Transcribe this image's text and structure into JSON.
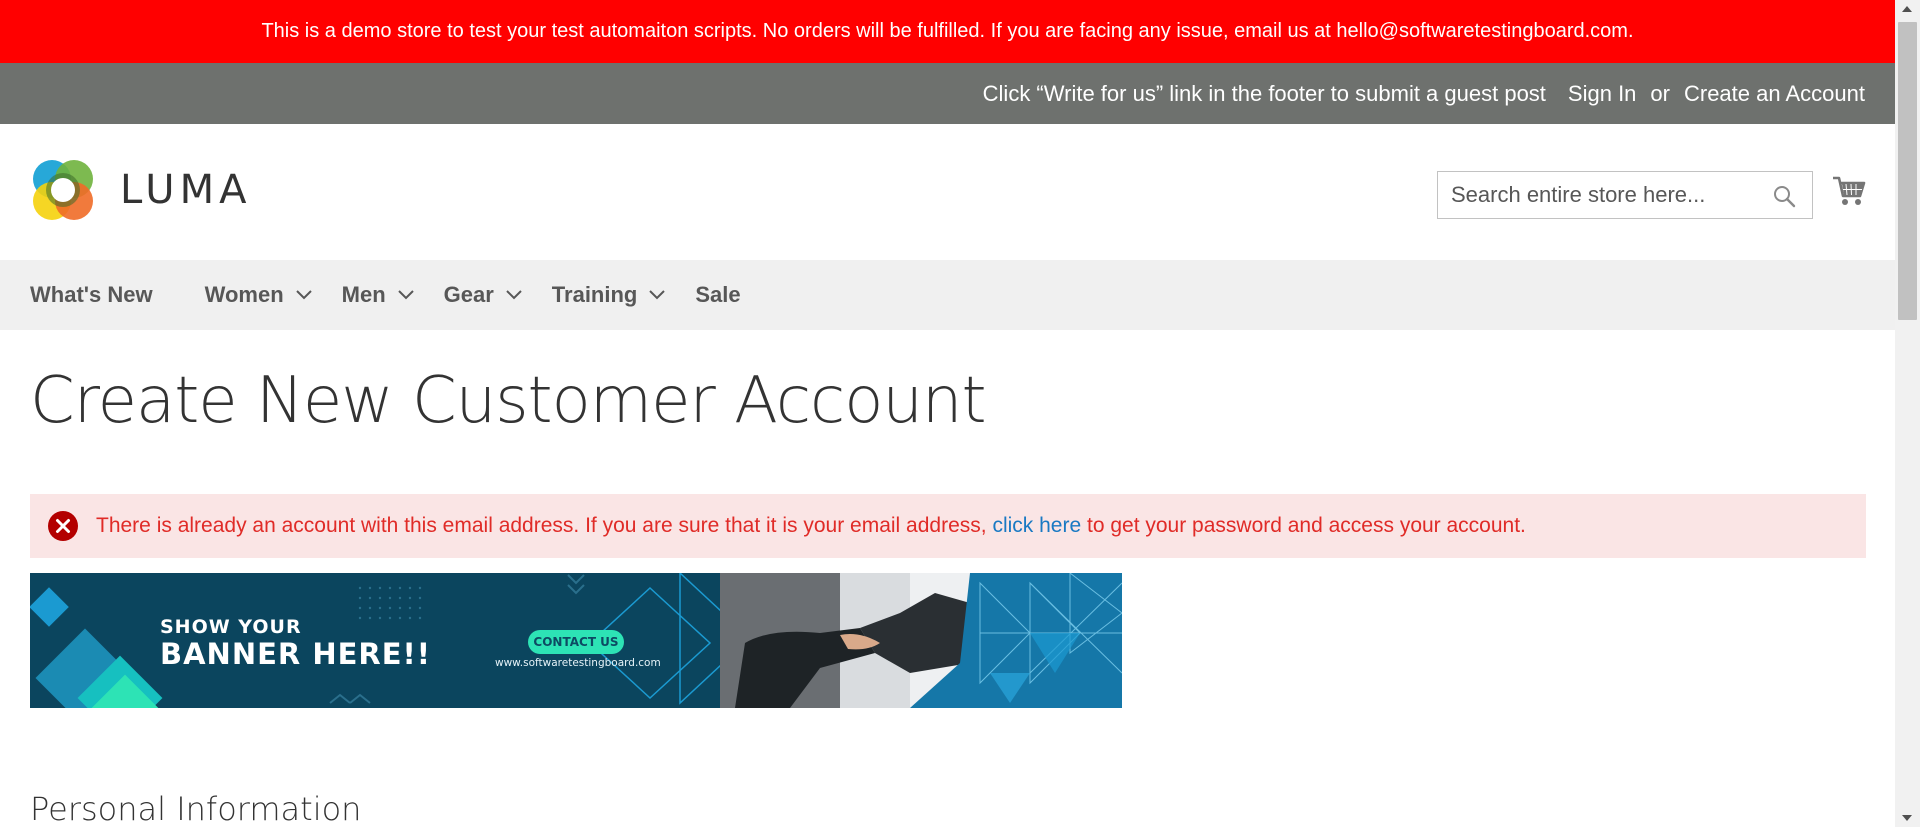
{
  "demo_notice": "This is a demo store to test your test automaiton scripts. No orders will be fulfilled. If you are facing any issue, email us at hello@softwaretestingboard.com.",
  "panel": {
    "welcome": "Click “Write for us” link in the footer to submit a guest post",
    "sign_in": "Sign In",
    "or": "or",
    "create_account": "Create an Account"
  },
  "logo": {
    "text": "LUMA"
  },
  "search": {
    "placeholder": "Search entire store here..."
  },
  "nav": {
    "items": [
      {
        "label": "What's New",
        "has_dropdown": false
      },
      {
        "label": "Women",
        "has_dropdown": true
      },
      {
        "label": "Men",
        "has_dropdown": true
      },
      {
        "label": "Gear",
        "has_dropdown": true
      },
      {
        "label": "Training",
        "has_dropdown": true
      },
      {
        "label": "Sale",
        "has_dropdown": false
      }
    ]
  },
  "page_title": "Create New Customer Account",
  "error": {
    "before": "There is already an account with this email address. If you are sure that it is your email address,",
    "link": "click here",
    "after": "to get your password and access your account."
  },
  "banner": {
    "line1": "SHOW YOUR",
    "line2": "BANNER HERE!!",
    "cta": "CONTACT US",
    "url": "www.softwaretestingboard.com"
  },
  "section_title": "Personal Information",
  "colors": {
    "demo_bar": "#ff0000",
    "panel": "#6e716e",
    "nav_bg": "#f0f0f0",
    "error_bg": "#fae5e5",
    "error_text": "#e02b27",
    "link": "#1979c3",
    "banner_bg": "#0d4a63",
    "banner_cta": "#2de3b5"
  },
  "icons": {
    "search": "search-icon",
    "cart": "cart-icon",
    "error": "error-icon",
    "chevron": "chevron-down-icon"
  }
}
